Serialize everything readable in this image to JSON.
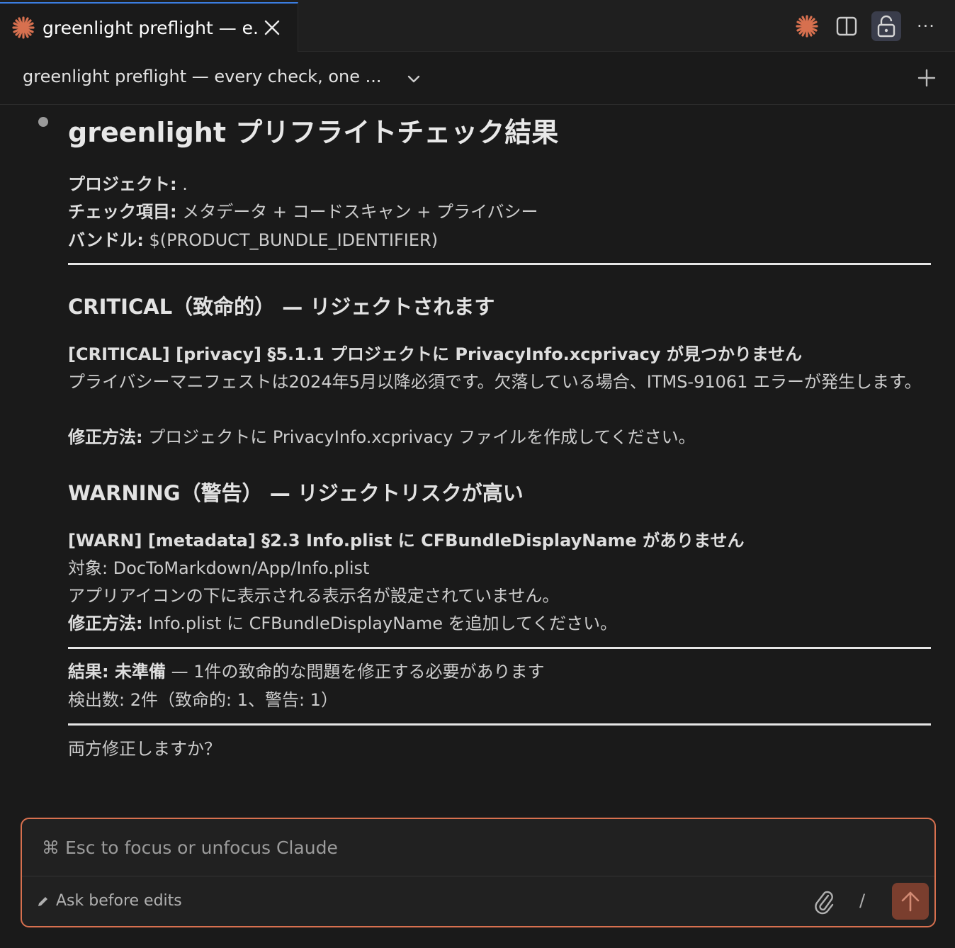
{
  "colors": {
    "accent": "#d7704f",
    "tab_indicator": "#3b7de0",
    "background": "#1a1a1a"
  },
  "tab": {
    "title": "greenlight preflight — e...",
    "icon": "claude-spark-icon",
    "close_icon": "close-icon"
  },
  "toolbar": {
    "icons": [
      "claude-spark-icon",
      "split-editor-icon",
      "lock-icon",
      "more-icon"
    ],
    "more_label": "···"
  },
  "session": {
    "title": "greenlight preflight — every check, one ...",
    "new_icon": "plus-icon"
  },
  "message": {
    "title": "greenlight プリフライトチェック結果",
    "project_label": "プロジェクト:",
    "project_value": " .",
    "checks_label": "チェック項目:",
    "checks_value": " メタデータ + コードスキャン + プライバシー",
    "bundle_label": "バンドル:",
    "bundle_value": " $(PRODUCT_BUNDLE_IDENTIFIER)",
    "critical_heading": "CRITICAL（致命的） — リジェクトされます",
    "critical_item_title": "[CRITICAL] [privacy] §5.1.1 プロジェクトに PrivacyInfo.xcprivacy が見つかりません",
    "critical_item_desc": "プライバシーマニフェストは2024年5月以降必須です。欠落している場合、ITMS-91061 エラーが発生します。",
    "critical_fix_label": "修正方法:",
    "critical_fix_value": " プロジェクトに PrivacyInfo.xcprivacy ファイルを作成してください。",
    "warning_heading": "WARNING（警告） — リジェクトリスクが高い",
    "warning_item_title": "[WARN] [metadata] §2.3 Info.plist に CFBundleDisplayName がありません",
    "warning_target": "対象: DocToMarkdown/App/Info.plist",
    "warning_desc": "アプリアイコンの下に表示される表示名が設定されていません。",
    "warning_fix_label": "修正方法:",
    "warning_fix_value": " Info.plist に CFBundleDisplayName を追加してください。",
    "result_label": "結果: 未準備",
    "result_value": " — 1件の致命的な問題を修正する必要があります",
    "count_line": "検出数: 2件（致命的: 1、警告: 1）",
    "question": "両方修正しますか？"
  },
  "composer": {
    "placeholder": "⌘ Esc to focus or unfocus Claude",
    "mode_label": "Ask before edits",
    "slash_label": "/",
    "icons": [
      "pencil-icon",
      "paperclip-icon",
      "arrow-up-icon"
    ]
  }
}
